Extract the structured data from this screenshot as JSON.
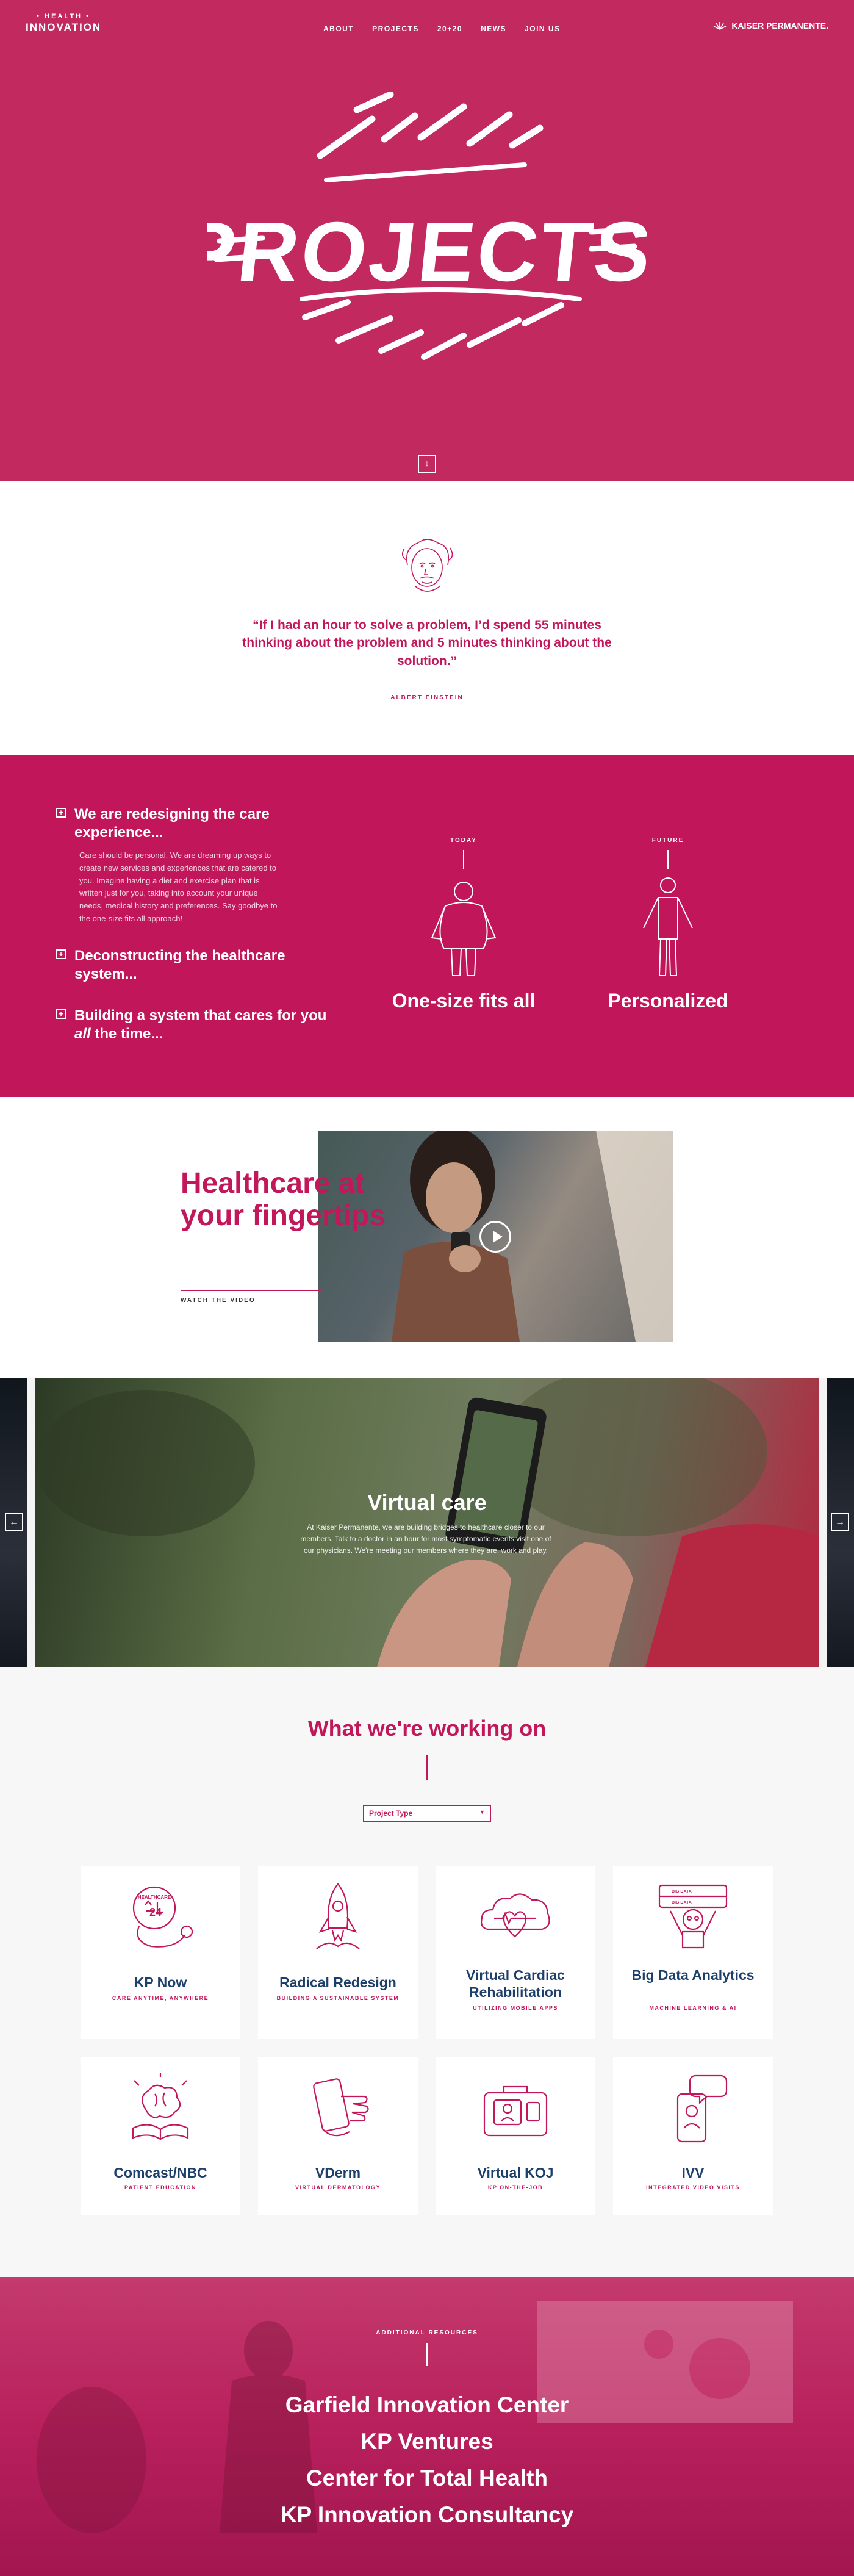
{
  "header": {
    "logo_small": "• HEALTH •",
    "logo_big": "INNOVATION",
    "nav": [
      "ABOUT",
      "PROJECTS",
      "20+20",
      "NEWS",
      "JOIN US"
    ],
    "kp_name": "KAISER PERMANENTE."
  },
  "hero": {
    "title": "PROJECTS"
  },
  "quote": {
    "text": "“If I had an hour to solve a problem, I’d spend 55 minutes thinking about the problem and 5 minutes thinking about the solution.”",
    "author": "ALBERT EINSTEIN"
  },
  "redesign": {
    "items": [
      {
        "title": "We are redesigning the care experience...",
        "body": "Care should be personal. We are dreaming up ways to create new services and experiences that are catered to you. Imagine having a diet and exercise plan that is written just for you, taking into account your unique needs, medical history and preferences. Say goodbye to the one-size fits all approach!"
      },
      {
        "title": "Deconstructing the healthcare system..."
      },
      {
        "title_pre": "Building a system that cares for you ",
        "title_em": "all",
        "title_post": " the time..."
      }
    ],
    "today_label": "TODAY",
    "today_caption": "One-size fits all",
    "future_label": "FUTURE",
    "future_caption": "Personalized"
  },
  "fingertips": {
    "title": "Healthcare at your fingertips",
    "link": "WATCH THE VIDEO"
  },
  "carousel": {
    "title": "Virtual care",
    "body": "At Kaiser Permanente, we are building bridges to healthcare closer to our members. Talk to a doctor in an hour for most symptomatic events visit one of our physicians. We're meeting our members where they are, work and play."
  },
  "work": {
    "title": "What we're working on",
    "filter_placeholder": "Project Type",
    "projects": [
      {
        "title": "KP Now",
        "subtitle": "CARE ANYTIME, ANYWHERE",
        "icon": "stethoscope-clock-icon"
      },
      {
        "title": "Radical Redesign",
        "subtitle": "BUILDING A SUSTAINABLE SYSTEM",
        "icon": "rocket-icon"
      },
      {
        "title": "Virtual Cardiac Rehabilitation",
        "subtitle": "UTILIZING MOBILE APPS",
        "icon": "heart-cloud-icon"
      },
      {
        "title": "Big Data Analytics",
        "subtitle": "MACHINE LEARNING & AI",
        "icon": "robot-data-icon"
      },
      {
        "title": "Comcast/NBC",
        "subtitle": "PATIENT EDUCATION",
        "icon": "brain-book-icon"
      },
      {
        "title": "VDerm",
        "subtitle": "VIRTUAL DERMATOLOGY",
        "icon": "hand-phone-icon"
      },
      {
        "title": "Virtual KOJ",
        "subtitle": "KP ON-THE-JOB",
        "icon": "medical-case-icon"
      },
      {
        "title": "IVV",
        "subtitle": "INTEGRATED VIDEO VISITS",
        "icon": "phone-chat-icon"
      }
    ]
  },
  "resources": {
    "label": "ADDITIONAL RESOURCES",
    "links": [
      "Garfield Innovation Center",
      "KP Ventures",
      "Center for Total Health",
      "KP Innovation Consultancy"
    ]
  },
  "colors": {
    "brand": "#c2295f",
    "deep": "#c1175a",
    "navy": "#1d3f6b"
  }
}
